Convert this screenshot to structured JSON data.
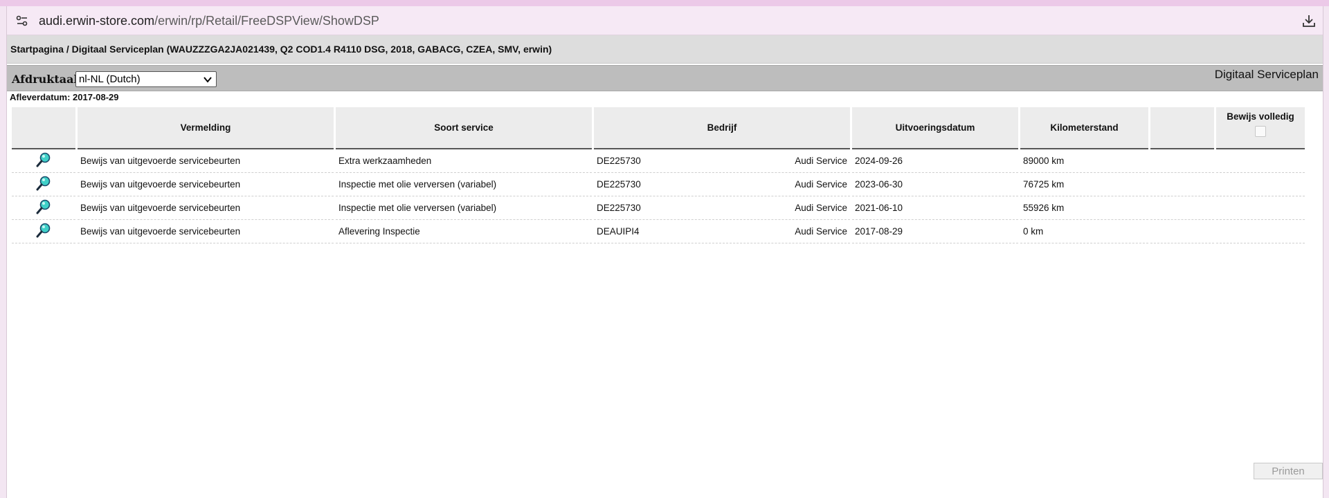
{
  "browser": {
    "url_host": "audi.erwin-store.com",
    "url_path": "/erwin/rp/Retail/FreeDSPView/ShowDSP"
  },
  "breadcrumb": "Startpagina / Digitaal Serviceplan (WAUZZZGA2JA021439, Q2 COD1.4 R4110 DSG, 2018, GABACG, CZEA, SMV, erwin)",
  "toolbar": {
    "print_language_label": "Afdruktaal:",
    "language_selected": "nl-NL (Dutch)",
    "plan_title": "Digitaal Serviceplan"
  },
  "delivery_date": "Afleverdatum: 2017-08-29",
  "table": {
    "columns": [
      "",
      "Vermelding",
      "Soort service",
      "Bedrijf",
      "Uitvoeringsdatum",
      "Kilometerstand",
      "",
      "Bewijs volledig"
    ],
    "rows": [
      {
        "entry": "Bewijs van uitgevoerde servicebeurten",
        "service_type": "Extra werkzaamheden",
        "company_code": "DE225730",
        "company_name": "Audi Service",
        "date": "2024-09-26",
        "mileage": "89000 km"
      },
      {
        "entry": "Bewijs van uitgevoerde servicebeurten",
        "service_type": "Inspectie met olie verversen (variabel)",
        "company_code": "DE225730",
        "company_name": "Audi Service",
        "date": "2023-06-30",
        "mileage": "76725 km"
      },
      {
        "entry": "Bewijs van uitgevoerde servicebeurten",
        "service_type": "Inspectie met olie verversen (variabel)",
        "company_code": "DE225730",
        "company_name": "Audi Service",
        "date": "2021-06-10",
        "mileage": "55926 km"
      },
      {
        "entry": "Bewijs van uitgevoerde servicebeurten",
        "service_type": "Aflevering Inspectie",
        "company_code": "DEAUIPI4",
        "company_name": "Audi Service",
        "date": "2017-08-29",
        "mileage": "0 km"
      }
    ]
  },
  "print_button": "Printen",
  "icons": {
    "site": "site-settings-icon",
    "download": "download-icon",
    "row_view": "magnifier-icon",
    "dropdown": "chevron-down-icon"
  },
  "colors": {
    "browser_chrome": "#f6e9f5",
    "breadcrumb_bg": "#dddddd",
    "toolbar_bg": "#bdbdbd",
    "header_bg": "#ececec",
    "magnifier_lens": "#3fd0c8"
  }
}
